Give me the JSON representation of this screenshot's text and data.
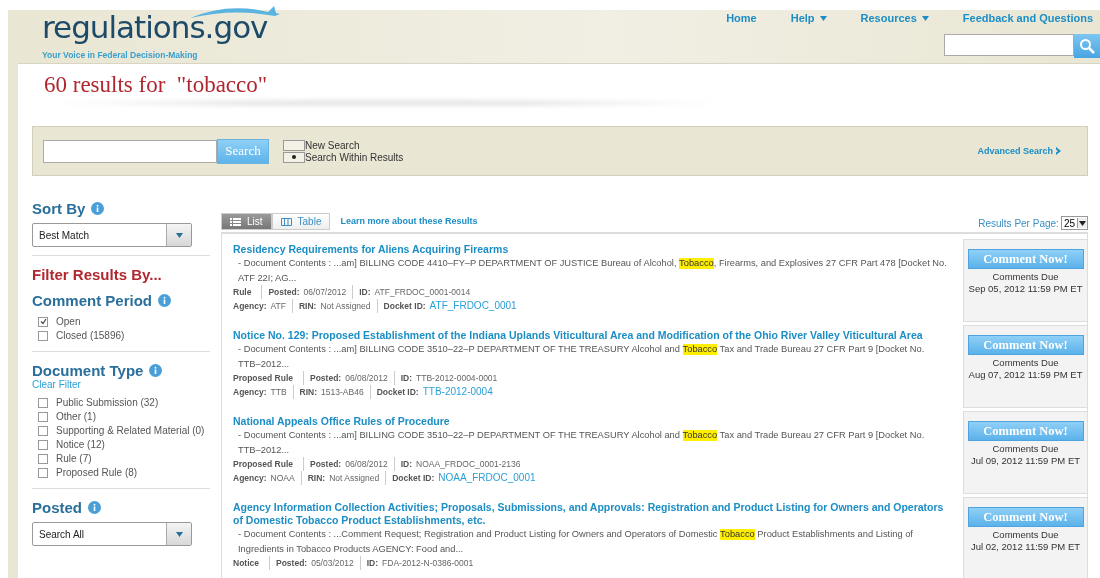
{
  "header": {
    "logo": "regulations.gov",
    "tagline": "Your Voice in Federal Decision-Making",
    "nav": [
      {
        "label": "Home",
        "dropdown": false
      },
      {
        "label": "Help",
        "dropdown": true
      },
      {
        "label": "Resources",
        "dropdown": true
      },
      {
        "label": "Feedback and Questions",
        "dropdown": false
      }
    ]
  },
  "results_title": "60 results for  \"tobacco\"",
  "search_bar": {
    "button": "Search",
    "options": [
      {
        "label": "New Search",
        "selected": false
      },
      {
        "label": "Search Within Results",
        "selected": true
      }
    ],
    "advanced": "Advanced Search"
  },
  "sidebar": {
    "sort_title": "Sort By",
    "sort_value": "Best Match",
    "filter_title": "Filter Results By...",
    "sections": [
      {
        "title": "Comment Period",
        "items": [
          {
            "label": "Open",
            "checked": true
          },
          {
            "label": "Closed (15896)",
            "checked": false
          }
        ]
      },
      {
        "title": "Document Type",
        "clear": "Clear Filter",
        "items": [
          {
            "label": "Public Submission (32)",
            "checked": false
          },
          {
            "label": "Other (1)",
            "checked": false
          },
          {
            "label": "Supporting & Related Material (0)",
            "checked": false
          },
          {
            "label": "Notice (12)",
            "checked": false
          },
          {
            "label": "Rule (7)",
            "checked": false
          },
          {
            "label": "Proposed Rule (8)",
            "checked": false
          }
        ]
      }
    ],
    "posted_title": "Posted",
    "posted_value": "Search All"
  },
  "view_tabs": [
    {
      "label": "List",
      "selected": true
    },
    {
      "label": "Table",
      "selected": false
    }
  ],
  "learn_more": "Learn more about these Results",
  "per_page": {
    "label": "Results Per Page:",
    "value": "25"
  },
  "results": [
    {
      "title": "Residency Requirements for Aliens Acquiring Firearms",
      "excerpt": [
        {
          "text": "- Document Contents : ...am] BILLING CODE 4410–FY–P DEPARTMENT OF JUSTICE Bureau of Alcohol, ",
          "highlighted": false
        },
        {
          "text": "Tobacco",
          "highlighted": true
        },
        {
          "text": ", Firearms, and Explosives 27 CFR Part 478 [Docket No. ATF 22I; AG...",
          "highlighted": false
        }
      ],
      "meta": [
        [
          {
            "label": "Rule"
          },
          {
            "label": "Posted:",
            "value": "06/07/2012"
          },
          {
            "label": "ID:",
            "value": "ATF_FRDOC_0001-0014"
          }
        ],
        [
          {
            "label": "Agency:",
            "value": "ATF"
          },
          {
            "label": "RIN:",
            "value": "Not Assigned"
          },
          {
            "label": "Docket ID:",
            "value": "ATF_FRDOC_0001",
            "link": true
          }
        ]
      ],
      "button": "Comment Now!",
      "due_label": "Comments Due",
      "due": "Sep 05, 2012 11:59 PM ET"
    },
    {
      "title": "Notice No. 129: Proposed Establishment of the Indiana Uplands Viticultural Area and Modification of the Ohio River Valley Viticultural Area",
      "excerpt": [
        {
          "text": "- Document Contents : ...am] BILLING CODE 3510–22–P DEPARTMENT OF THE TREASURY Alcohol and ",
          "highlighted": false
        },
        {
          "text": "Tobacco",
          "highlighted": true
        },
        {
          "text": " Tax and Trade Bureau 27 CFR Part 9 [Docket No. TTB–2012...",
          "highlighted": false
        }
      ],
      "meta": [
        [
          {
            "label": "Proposed Rule"
          },
          {
            "label": "Posted:",
            "value": "06/08/2012"
          },
          {
            "label": "ID:",
            "value": "TTB-2012-0004-0001"
          }
        ],
        [
          {
            "label": "Agency:",
            "value": "TTB"
          },
          {
            "label": "RIN:",
            "value": "1513-AB46"
          },
          {
            "label": "Docket ID:",
            "value": "TTB-2012-0004",
            "link": true
          }
        ]
      ],
      "button": "Comment Now!",
      "due_label": "Comments Due",
      "due": "Aug 07, 2012 11:59 PM ET"
    },
    {
      "title": "National Appeals Office Rules of Procedure",
      "excerpt": [
        {
          "text": "- Document Contents : ...am] BILLING CODE 3510–22–P DEPARTMENT OF THE TREASURY Alcohol and ",
          "highlighted": false
        },
        {
          "text": "Tobacco",
          "highlighted": true
        },
        {
          "text": " Tax and Trade Bureau 27 CFR Part 9 [Docket No. TTB–2012...",
          "highlighted": false
        }
      ],
      "meta": [
        [
          {
            "label": "Proposed Rule"
          },
          {
            "label": "Posted:",
            "value": "06/08/2012"
          },
          {
            "label": "ID:",
            "value": "NOAA_FRDOC_0001-2136"
          }
        ],
        [
          {
            "label": "Agency:",
            "value": "NOAA"
          },
          {
            "label": "RIN:",
            "value": "Not Assigned"
          },
          {
            "label": "Docket ID:",
            "value": "NOAA_FRDOC_0001",
            "link": true
          }
        ]
      ],
      "button": "Comment Now!",
      "due_label": "Comments Due",
      "due": "Jul 09, 2012 11:59 PM ET"
    },
    {
      "title": "Agency Information Collection Activities; Proposals, Submissions, and Approvals: Registration and Product Listing for Owners and Operators of Domestic Tobacco Product Establishments, etc.",
      "excerpt": [
        {
          "text": "- Document Contents : ...Comment Request; Registration and Product Listing for Owners and Operators of Domestic ",
          "highlighted": false
        },
        {
          "text": "Tobacco",
          "highlighted": true
        },
        {
          "text": " Product Establishments and Listing of Ingredients in Tobacco Products AGENCY: Food and...",
          "highlighted": false
        }
      ],
      "meta": [
        [
          {
            "label": "Notice"
          },
          {
            "label": "Posted:",
            "value": "05/03/2012"
          },
          {
            "label": "ID:",
            "value": "FDA-2012-N-0386-0001"
          }
        ]
      ],
      "button": "Comment Now!",
      "due_label": "Comments Due",
      "due": "Jul 02, 2012 11:59 PM ET"
    }
  ]
}
